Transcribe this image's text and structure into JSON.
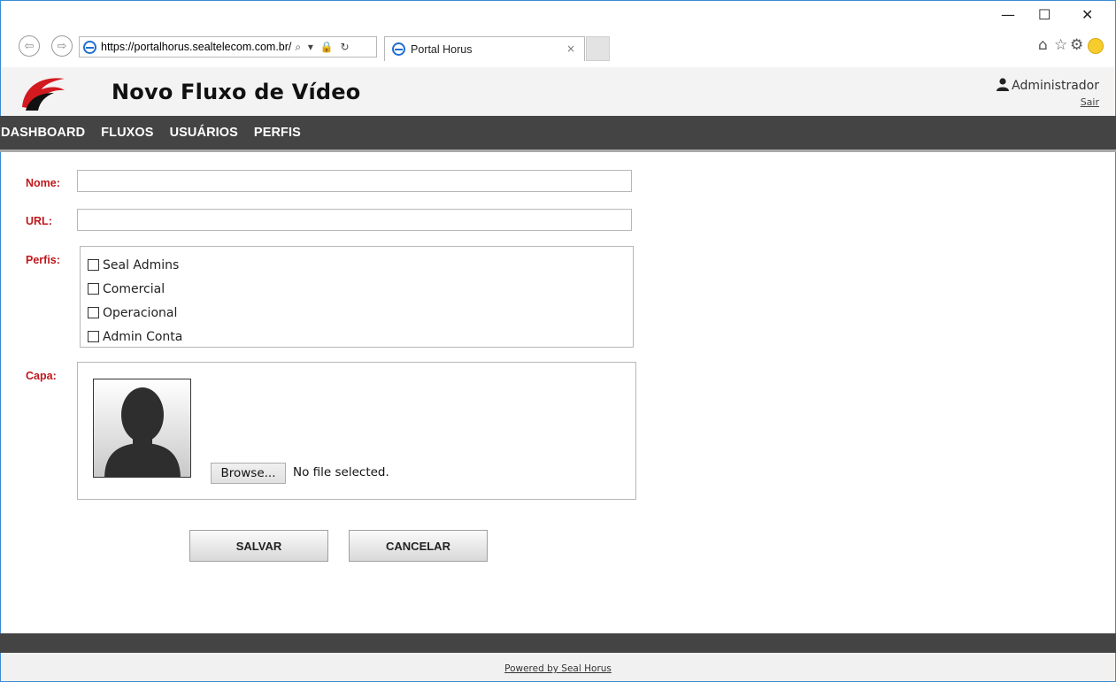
{
  "browser": {
    "address_url": "https://portalhorus.sealtelecom.com.br/",
    "address_controls": "⌕ ▾ 🔒 ↻",
    "tab_title": "Portal Horus",
    "tab_close": "×",
    "win_min": "—",
    "win_max": "☐",
    "win_close": "✕",
    "back": "⇦",
    "forward": "⇨",
    "home": "⌂",
    "favorites": "☆",
    "settings": "⚙"
  },
  "header": {
    "title": "Novo Fluxo de Vídeo",
    "user_name": "Administrador",
    "logout": "Sair"
  },
  "menu": {
    "items": [
      "DASHBOARD",
      "FLUXOS",
      "USUÁRIOS",
      "PERFIS"
    ]
  },
  "form": {
    "nome_label": "Nome:",
    "nome_value": "",
    "url_label": "URL:",
    "url_value": "",
    "perfis_label": "Perfis:",
    "perfis": [
      "Seal Admins",
      "Comercial",
      "Operacional",
      "Admin Conta"
    ],
    "capa_label": "Capa:",
    "browse_label": "Browse...",
    "file_status": "No file selected.",
    "save_label": "SALVAR",
    "cancel_label": "CANCELAR"
  },
  "footer": {
    "powered_by": "Powered by Seal Horus"
  },
  "colors": {
    "accent_red": "#c0171c",
    "nav_dark": "#444444",
    "window_border": "#3c8bd3"
  }
}
